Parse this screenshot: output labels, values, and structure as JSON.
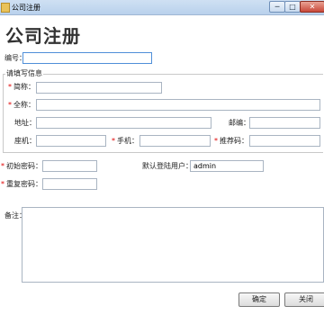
{
  "window": {
    "title": "公司注册",
    "min_glyph": "─",
    "max_glyph": "□",
    "close_glyph": "✕"
  },
  "heading": "公司注册",
  "fields": {
    "code": {
      "label": "编号：",
      "value": ""
    },
    "group_title": "请填写信息",
    "short_name": {
      "label": "简称：",
      "value": ""
    },
    "full_name": {
      "label": "全称：",
      "value": ""
    },
    "address": {
      "label": "地址：",
      "value": ""
    },
    "postcode": {
      "label": "邮编：",
      "value": ""
    },
    "phone": {
      "label": "座机：",
      "value": ""
    },
    "mobile": {
      "label": "手机：",
      "value": ""
    },
    "referral": {
      "label": "推荐码：",
      "value": ""
    },
    "init_password": {
      "label": "初始密码：",
      "value": ""
    },
    "default_user": {
      "label": "默认登陆用户：",
      "value": "admin"
    },
    "repeat_password": {
      "label": "重复密码：",
      "value": ""
    },
    "remark": {
      "label": "备注：",
      "value": ""
    }
  },
  "required_mark": "*",
  "buttons": {
    "ok": "确定",
    "close": "关闭"
  }
}
